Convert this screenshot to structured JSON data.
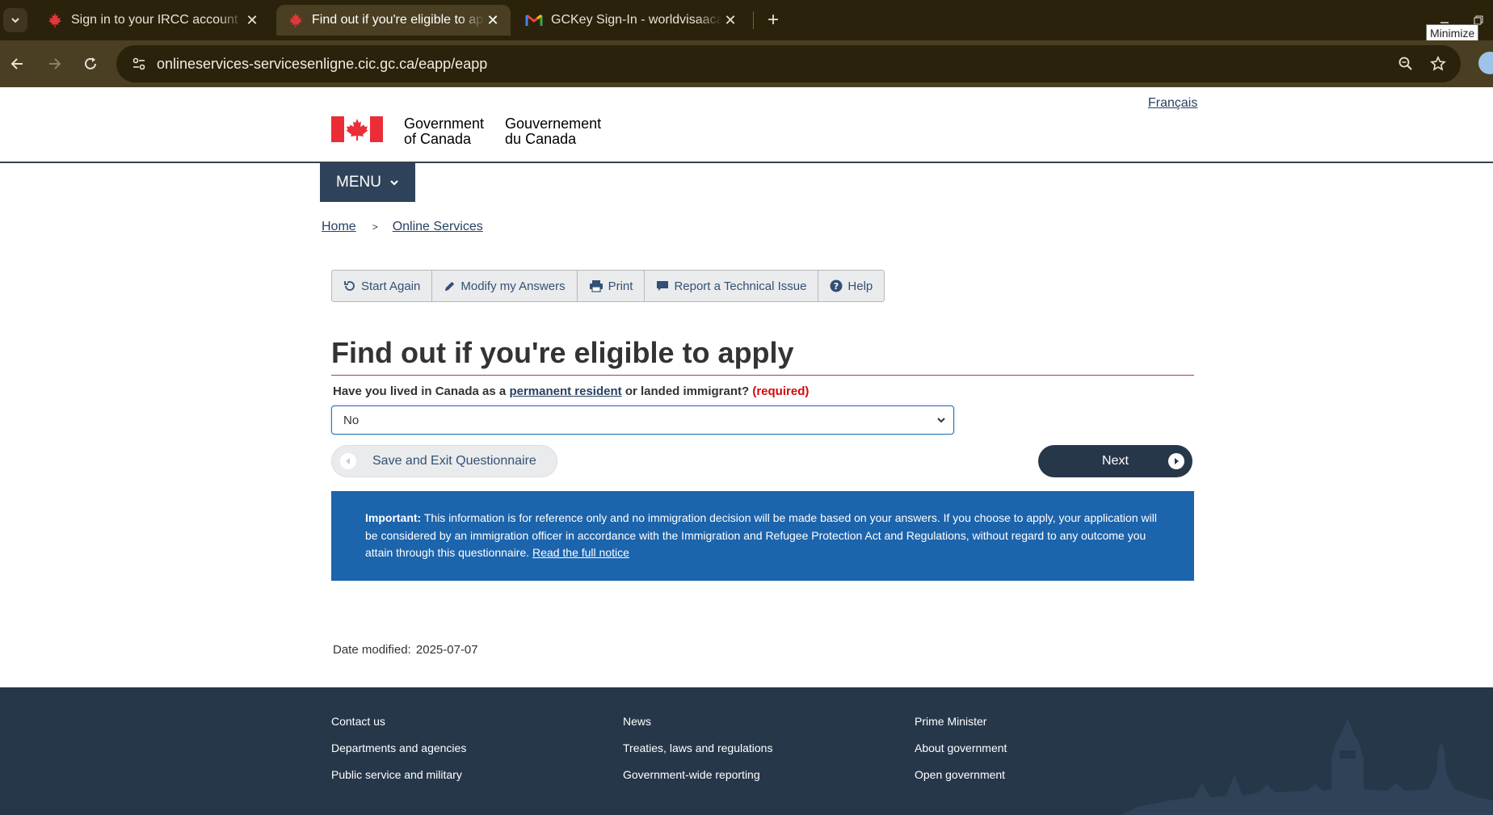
{
  "browser": {
    "tabs": [
      {
        "title": "Sign in to your IRCC account - G",
        "icon": "maple-leaf-icon",
        "active": false
      },
      {
        "title": "Find out if you're eligible to apply",
        "icon": "maple-leaf-icon",
        "active": true
      },
      {
        "title": "GCKey Sign-In - worldvisaacade",
        "icon": "gmail-icon",
        "active": false
      }
    ],
    "url": "onlineservices-servicesenligne.cic.gc.ca/eapp/eapp",
    "tooltip": "Minimize"
  },
  "header": {
    "language_link": "Français",
    "signature_en_line1": "Government",
    "signature_en_line2": "of Canada",
    "signature_fr_line1": "Gouvernement",
    "signature_fr_line2": "du Canada",
    "menu_label": "MENU"
  },
  "breadcrumb": {
    "items": [
      "Home",
      "Online Services"
    ],
    "separator": ">"
  },
  "tools": [
    {
      "label": "Start Again",
      "icon": "refresh-icon"
    },
    {
      "label": "Modify my Answers",
      "icon": "pencil-icon"
    },
    {
      "label": "Print",
      "icon": "printer-icon"
    },
    {
      "label": "Report a Technical Issue",
      "icon": "comment-icon"
    },
    {
      "label": "Help",
      "icon": "question-circle-icon"
    }
  ],
  "main": {
    "title": "Find out if you're eligible to apply",
    "question_prefix": "Have you lived in Canada as a ",
    "question_link": "permanent resident",
    "question_suffix": " or landed immigrant? ",
    "required_label": "(required)",
    "select_value": "No",
    "save_button": "Save and Exit Questionnaire",
    "next_button": "Next",
    "notice_bold": "Important:",
    "notice_text": " This information is for reference only and no immigration decision will be made based on your answers. If you choose to apply, your application will be considered by an immigration officer in accordance with the Immigration and Refugee Protection Act and Regulations, without regard to any outcome you attain through this questionnaire. ",
    "notice_link": "Read the full notice",
    "date_label": "Date modified:",
    "date_value": "2025-07-07"
  },
  "footer": {
    "col1": [
      "Contact us",
      "Departments and agencies",
      "Public service and military"
    ],
    "col2": [
      "News",
      "Treaties, laws and regulations",
      "Government-wide reporting"
    ],
    "col3": [
      "Prime Minister",
      "About government",
      "Open government"
    ]
  },
  "colors": {
    "browser_frame": "#2b220b",
    "browser_toolbar": "#4a3f22",
    "canada_red": "#eb2d37",
    "nav_dark": "#26374a",
    "link": "#284162",
    "notice_blue": "#1c64ac",
    "required_red": "#d3080c"
  }
}
